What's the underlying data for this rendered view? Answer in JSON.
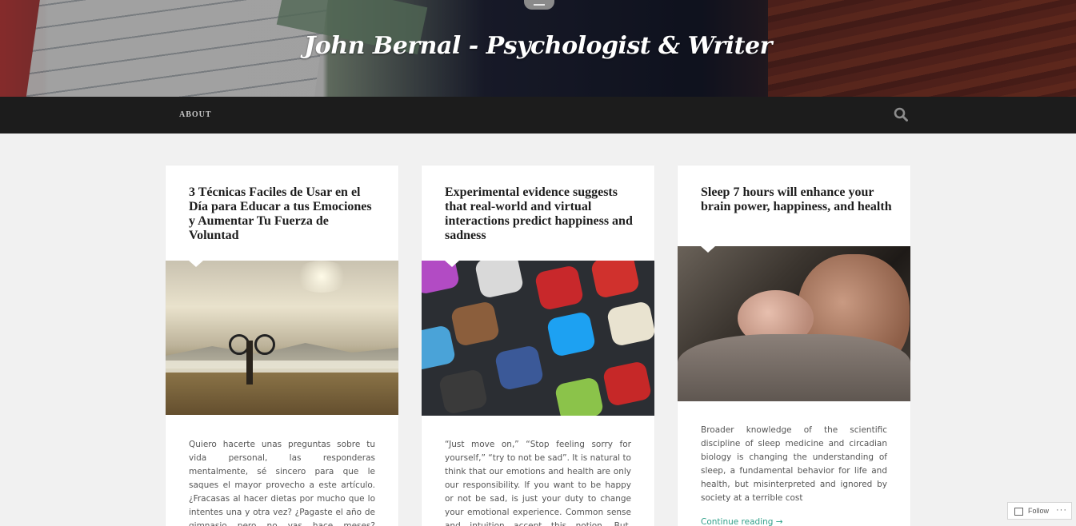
{
  "header": {
    "site_title": "John Bernal - Psychologist & Writer"
  },
  "nav": {
    "items": [
      {
        "label": "ABOUT"
      }
    ],
    "search_icon": "search-icon"
  },
  "posts": [
    {
      "title": "3 Técnicas Faciles de Usar en el Día para Educar a tus Emociones y Aumentar Tu Fuerza de Voluntad",
      "excerpt": "Quiero hacerte unas preguntas sobre tu vida personal, las responderas mentalmente, sé sincero para que le saques el mayor provecho a este artículo. ¿Fracasas al hacer dietas por mucho que lo intentes una y otra vez? ¿Pagaste el año de gimnasio pero no vas hace meses? ¿Frecuentemente dejas el"
    },
    {
      "title": "Experimental evidence suggests that real-world and virtual interactions predict happiness and sadness",
      "excerpt": "“Just move on,” “Stop feeling sorry for yourself,” “try to not be sad”. It is natural to think that our emotions and health are only our responsibility. If you want to be happy or not be sad, is just your duty to change your emotional experience. Common sense and intuition accept this notion. But, findings"
    },
    {
      "title": "Sleep 7 hours will enhance your brain power, happiness, and health",
      "excerpt": "Broader knowledge of the scientific discipline of sleep medicine and circadian biology is changing the understanding of sleep, a fundamental behavior for life and health, but misinterpreted and ignored by society at a terrible cost",
      "continue_label": "Continue reading →"
    }
  ],
  "follow_widget": {
    "label": "Follow",
    "more": "···"
  },
  "colors": {
    "nav_bg": "#1c1c1c",
    "page_bg": "#f1f1f1",
    "link": "#31a08a"
  }
}
